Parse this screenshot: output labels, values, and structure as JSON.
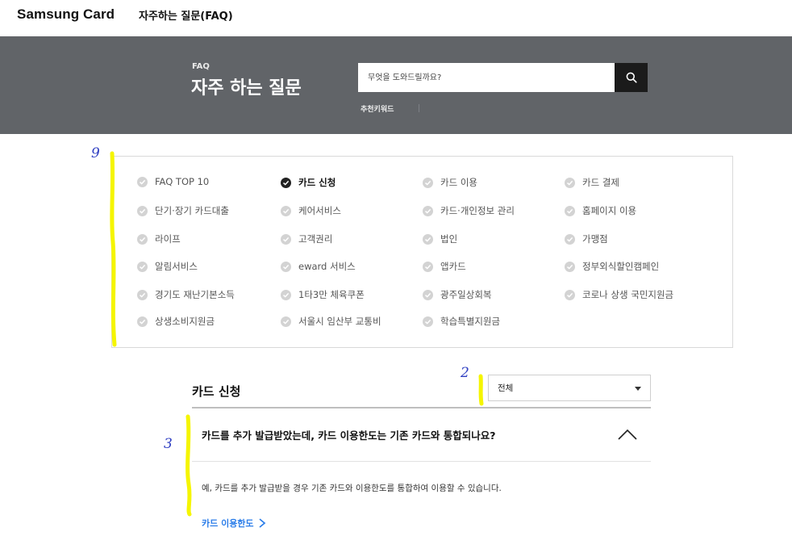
{
  "header": {
    "brand": "Samsung Card",
    "page_name": "자주하는 질문(FAQ)"
  },
  "hero": {
    "eyebrow": "FAQ",
    "title": "자주 하는 질문",
    "search_placeholder": "무엇을 도와드릴까요?",
    "search_icon": "search-icon",
    "recommended_label": "추천키워드"
  },
  "categories": [
    {
      "label": "FAQ TOP 10",
      "active": false
    },
    {
      "label": "카드 신청",
      "active": true
    },
    {
      "label": "카드 이용",
      "active": false
    },
    {
      "label": "카드 결제",
      "active": false
    },
    {
      "label": "단기·장기 카드대출",
      "active": false
    },
    {
      "label": "케어서비스",
      "active": false
    },
    {
      "label": "카드·개인정보 관리",
      "active": false
    },
    {
      "label": "홈페이지 이용",
      "active": false
    },
    {
      "label": "라이프",
      "active": false
    },
    {
      "label": "고객권리",
      "active": false
    },
    {
      "label": "법인",
      "active": false
    },
    {
      "label": "가맹점",
      "active": false
    },
    {
      "label": "알림서비스",
      "active": false
    },
    {
      "label": "eward 서비스",
      "active": false
    },
    {
      "label": "앱카드",
      "active": false
    },
    {
      "label": "정부외식할인캠페인",
      "active": false
    },
    {
      "label": "경기도 재난기본소득",
      "active": false
    },
    {
      "label": "1타3만 체육쿠폰",
      "active": false
    },
    {
      "label": "광주일상회복",
      "active": false
    },
    {
      "label": "코로나 상생 국민지원금",
      "active": false
    },
    {
      "label": "상생소비지원금",
      "active": false
    },
    {
      "label": "서울시 임산부 교통비",
      "active": false
    },
    {
      "label": "학습특별지원금",
      "active": false
    }
  ],
  "section": {
    "title": "카드 신청",
    "filter_value": "전체"
  },
  "faq": {
    "question": "카드를 추가 발급받았는데, 카드 이용한도는 기존 카드와 통합되나요?",
    "answer": "예, 카드를 추가 발급받을 경우 기존 카드와 이용한도를 통합하여 이용할 수 있습니다.",
    "link_label": "카드 이용한도",
    "expanded": true
  },
  "annotations": {
    "marks": [
      "9",
      "2",
      "3"
    ],
    "color": "#f5f500"
  },
  "colors": {
    "hero_bg": "#616468",
    "link": "#2b7de9",
    "active_check": "#222222",
    "inactive_check": "#d3d3d3"
  }
}
